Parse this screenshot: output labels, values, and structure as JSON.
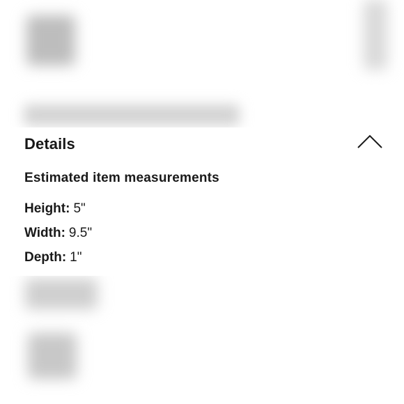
{
  "details": {
    "title": "Details",
    "toggle_icon": "chevron-up-icon",
    "section_heading": "Estimated item measurements",
    "measurements": [
      {
        "label": "Height:",
        "value": "5\""
      },
      {
        "label": "Width:",
        "value": "9.5\""
      },
      {
        "label": "Depth:",
        "value": "1\""
      }
    ]
  },
  "colors": {
    "text": "#1a1a1a",
    "background": "#ffffff",
    "blurred_content": "#c9c9c9"
  }
}
